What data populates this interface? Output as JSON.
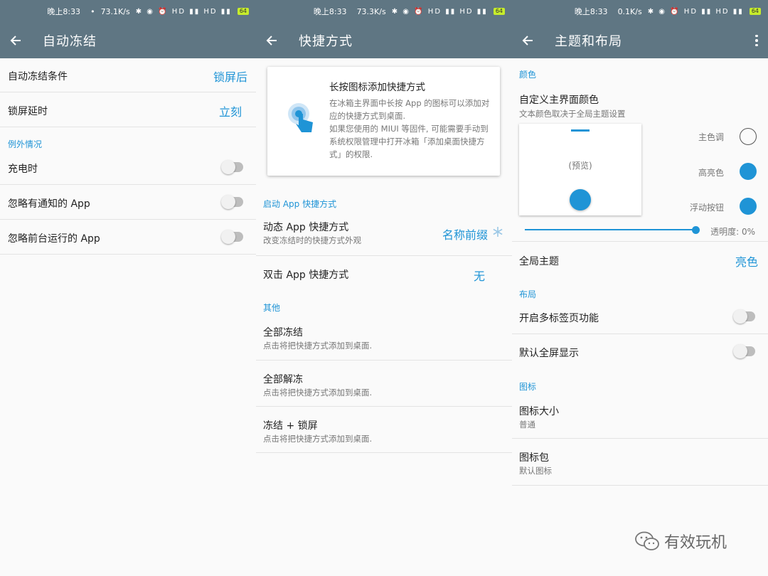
{
  "screens": [
    {
      "status": {
        "time": "晚上8:33",
        "speed": "73.1K/s",
        "battery": "64"
      },
      "title": "自动冻结",
      "rows": [
        {
          "title": "自动冻结条件",
          "value": "锁屏后"
        },
        {
          "title": "锁屏延时",
          "value": "立刻"
        }
      ],
      "section": "例外情况",
      "toggles": [
        {
          "title": "充电时",
          "on": false
        },
        {
          "title": "忽略有通知的 App",
          "on": false
        },
        {
          "title": "忽略前台运行的 App",
          "on": false
        }
      ]
    },
    {
      "status": {
        "time": "晚上8:33",
        "speed": "73.3K/s",
        "battery": "64"
      },
      "title": "快捷方式",
      "card": {
        "title": "长按图标添加快捷方式",
        "body": "在冰箱主界面中长按 App 的图标可以添加对应的快捷方式到桌面.\n如果您使用的 MIUI 等固件, 可能需要手动到系统权限管理中打开冰箱「添加桌面快捷方式」的权限."
      },
      "section1": "启动 App 快捷方式",
      "dynamic": {
        "title": "动态 App 快捷方式",
        "sub": "改变冻结时的快捷方式外观",
        "value": "名称前缀"
      },
      "double": {
        "title": "双击 App 快捷方式",
        "value": "无"
      },
      "section2": "其他",
      "others": [
        {
          "title": "全部冻结",
          "sub": "点击将把快捷方式添加到桌面."
        },
        {
          "title": "全部解冻",
          "sub": "点击将把快捷方式添加到桌面."
        },
        {
          "title": "冻结 + 锁屏",
          "sub": "点击将把快捷方式添加到桌面."
        }
      ]
    },
    {
      "status": {
        "time": "晚上8:33",
        "speed": "0.1K/s",
        "battery": "64"
      },
      "title": "主题和布局",
      "section_color": "颜色",
      "custom": {
        "title": "自定义主界面颜色",
        "sub": "文本颜色取决于全局主题设置"
      },
      "preview_text": "(预览)",
      "colors": [
        {
          "label": "主色调",
          "color": "#ffffff"
        },
        {
          "label": "高亮色",
          "color": "#1f94d6"
        },
        {
          "label": "浮动按钮",
          "color": "#1f94d6"
        }
      ],
      "alpha_label": "透明度: 0%",
      "global_theme": {
        "title": "全局主题",
        "value": "亮色"
      },
      "section_layout": "布局",
      "layout_toggles": [
        {
          "title": "开启多标签页功能",
          "on": false
        },
        {
          "title": "默认全屏显示",
          "on": false
        }
      ],
      "section_icon": "图标",
      "icon_rows": [
        {
          "title": "图标大小",
          "sub": "普通"
        },
        {
          "title": "图标包",
          "sub": "默认图标"
        }
      ]
    }
  ],
  "watermark": "有效玩机",
  "colors": {
    "toolbar": "#5f7683",
    "accent": "#1f94d6",
    "background": "#fafafa"
  }
}
